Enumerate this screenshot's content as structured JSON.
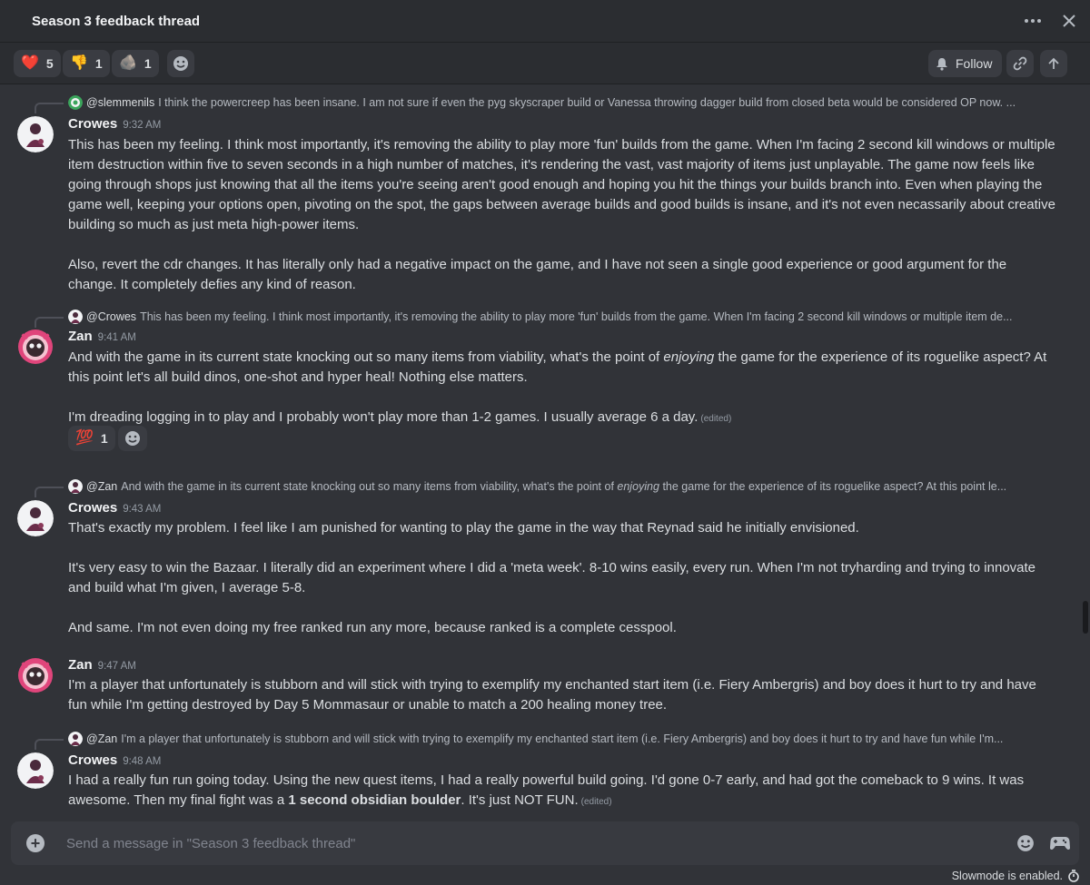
{
  "thread": {
    "title": "Season 3 feedback thread"
  },
  "header_icons": [
    "more-icon",
    "close-icon"
  ],
  "reactions": [
    {
      "emoji": "❤️",
      "icon": "heart-icon",
      "count": "5"
    },
    {
      "emoji": "👎",
      "icon": "thumbs-down-icon",
      "count": "1"
    },
    {
      "emoji": "🪨",
      "icon": "custom-emoji-icon",
      "count": "1"
    }
  ],
  "toolbar": {
    "follow_label": "Follow"
  },
  "messages": [
    {
      "reply_to": "@slemmenils",
      "reply_text": "I think the powercreep has been insane. I am not sure if even the pyg skyscraper build or Vanessa throwing dagger build from closed beta would be considered OP now. ...",
      "author": "Crowes",
      "time": "9:32 AM",
      "paragraphs": [
        "This has been my feeling. I think most importantly, it's removing the ability to play more 'fun' builds from the game. When I'm facing 2 second kill windows or multiple item destruction within five to seven seconds in a high number of matches, it's rendering the vast, vast majority of items just unplayable. The game now feels like going through shops just knowing that all the items you're seeing aren't good enough and hoping you hit the things your builds branch into. Even when playing the game well, keeping your options open, pivoting on the spot, the gaps between average builds and good builds is insane, and it's not even necassarily about creative building so much as just meta high-power items.",
        "Also, revert the cdr changes. It has literally only had a negative impact on the game, and I have not seen a single good experience or good argument for the change. It completely defies any kind of reason."
      ]
    },
    {
      "reply_to": "@Crowes",
      "reply_text": "This has been my feeling. I think most importantly, it's removing the ability to play more 'fun' builds from the game. When I'm facing 2 second kill windows or multiple item de...",
      "author": "Zan",
      "time": "9:41 AM",
      "p1_before": "And with the game in its current state knocking out so many items from viability, what's the point of ",
      "p1_em": "enjoying",
      "p1_after": " the game for the experience of its roguelike aspect? At this point let's all build dinos, one-shot and hyper heal! Nothing else matters.",
      "p2": "I'm dreading logging in to play and I probably won't play more than 1-2 games. I usually average 6 a day.",
      "edited": "(edited)",
      "reaction": {
        "emoji": "💯",
        "count": "1"
      }
    },
    {
      "reply_to": "@Zan",
      "reply_before": "And with the game in its current state knocking out so many items from viability, what's the point of ",
      "reply_em": "enjoying",
      "reply_after": " the game for the experience of its roguelike aspect? At this point le...",
      "author": "Crowes",
      "time": "9:43 AM",
      "paragraphs": [
        "That's exactly my problem. I feel like I am punished for wanting to play the game in the way that Reynad said he initially envisioned.",
        "It's very easy to win the Bazaar. I literally did an experiment where I did a 'meta week'. 8-10 wins easily, every run. When I'm not tryharding and trying to innovate and build what I'm given, I average 5-8.",
        "And same. I'm not even doing my free ranked run any more, because ranked is a complete cesspool."
      ]
    },
    {
      "author": "Zan",
      "time": "9:47 AM",
      "paragraphs": [
        "I'm a player that unfortunately is stubborn and will stick with trying to exemplify my enchanted start item (i.e. Fiery Ambergris) and boy does it hurt to try and have fun while I'm getting destroyed by Day 5 Mommasaur or unable to match a 200 healing money tree."
      ]
    },
    {
      "reply_to": "@Zan",
      "reply_text": "I'm a player that unfortunately is stubborn and will stick with trying to exemplify my enchanted start item (i.e. Fiery Ambergris) and boy does it hurt to try and have fun while I'm...",
      "author": "Crowes",
      "time": "9:48 AM",
      "p_before": "I had a really fun run going today. Using the new quest items, I had a really powerful build going. I'd gone 0-7 early, and had got the comeback to 9 wins. It was awesome. Then my final fight was a ",
      "p_strong": "1 second obsidian boulder",
      "p_after": ". It's just NOT FUN.",
      "edited": "(edited)"
    }
  ],
  "composer": {
    "placeholder": "Send a message in \"Season 3 feedback thread\""
  },
  "footer": {
    "slowmode": "Slowmode is enabled."
  }
}
